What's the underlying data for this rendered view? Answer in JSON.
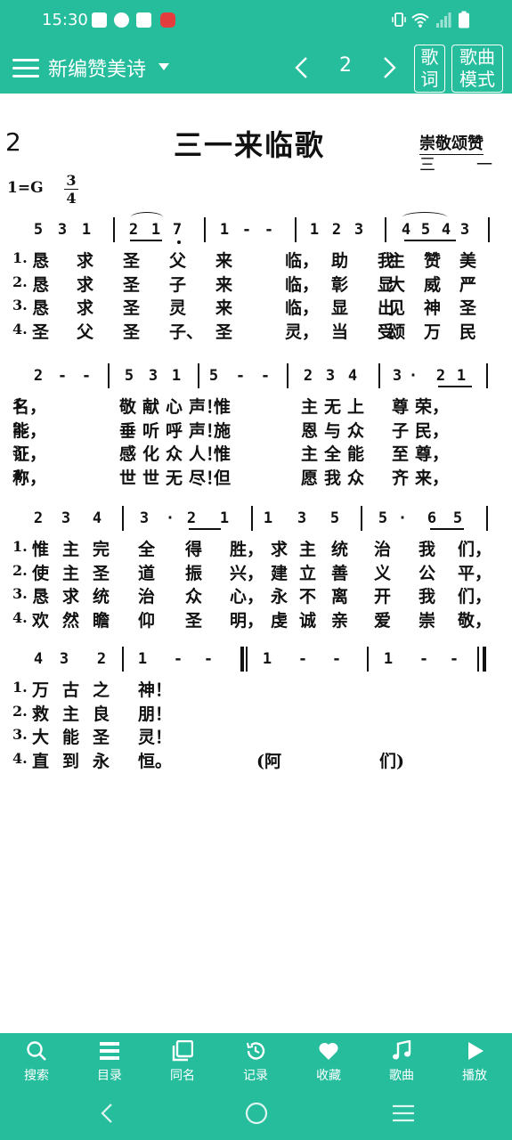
{
  "status_bar": {
    "time": "15:30"
  },
  "toolbar": {
    "book_title": "新编赞美诗",
    "page_number": "2",
    "lyrics_button": [
      "歌",
      "词"
    ],
    "score_mode_button": [
      "歌曲",
      "模式"
    ]
  },
  "score": {
    "page_number": "2",
    "title": "三一来临歌",
    "tune_name": "崇敬颂赞",
    "tune_sub": [
      "三",
      "一"
    ],
    "key": "1=G",
    "time_signature": {
      "top": "3",
      "bottom": "4"
    },
    "rows": [
      {
        "notes": [
          "5",
          "3",
          "1",
          "2",
          "1",
          "7",
          "1",
          "-",
          "-",
          "1",
          "2",
          "3",
          "4",
          "5",
          "4",
          "3"
        ],
        "verses": [
          [
            "1.",
            "恳",
            "求",
            "圣",
            "父",
            "来",
            "临，",
            "助",
            "我",
            "赞",
            "美",
            "主"
          ],
          [
            "2.",
            "恳",
            "求",
            "圣",
            "子",
            "来",
            "临，",
            "彰",
            "显",
            "威",
            "严",
            "大"
          ],
          [
            "3.",
            "恳",
            "求",
            "圣",
            "灵",
            "来",
            "临，",
            "显",
            "出",
            "神",
            "圣",
            "见"
          ],
          [
            "4.",
            "圣",
            "父",
            "圣",
            "子、",
            "圣",
            "灵，",
            "当",
            "受",
            "万",
            "民",
            "颂"
          ]
        ]
      },
      {
        "notes": [
          "2",
          "-",
          "-",
          "5",
          "3",
          "1",
          "5",
          "-",
          "-",
          "2",
          "3",
          "4",
          "3",
          "·",
          "2",
          "1"
        ],
        "verses": [
          [
            "1.",
            "名，",
            "敬",
            "献",
            "心",
            "声！",
            "惟",
            "主",
            "无",
            "上",
            "尊",
            "荣，"
          ],
          [
            "2.",
            "能，",
            "垂",
            "听",
            "呼",
            "声！",
            "施",
            "恩",
            "与",
            "众",
            "子",
            "民，"
          ],
          [
            "3.",
            "证，",
            "感",
            "化",
            "众",
            "人！",
            "惟",
            "主",
            "全",
            "能",
            "至",
            "尊，"
          ],
          [
            "4.",
            "称，",
            "世",
            "世",
            "无",
            "尽！",
            "但",
            "愿",
            "我",
            "众",
            "齐",
            "来，"
          ]
        ]
      },
      {
        "notes": [
          "2",
          "3",
          "4",
          "3",
          "·",
          "2",
          "1",
          "1",
          "3",
          "5",
          "5",
          "·",
          "6",
          "5"
        ],
        "verses": [
          [
            "1.",
            "惟",
            "主",
            "完",
            "全",
            "得",
            "胜，",
            "求",
            "主",
            "统",
            "治",
            "我",
            "们，"
          ],
          [
            "2.",
            "使",
            "主",
            "圣",
            "道",
            "振",
            "兴，",
            "建",
            "立",
            "善",
            "义",
            "公",
            "平，"
          ],
          [
            "3.",
            "恳",
            "求",
            "统",
            "治",
            "众",
            "心，",
            "永",
            "不",
            "离",
            "开",
            "我",
            "们，"
          ],
          [
            "4.",
            "欢",
            "然",
            "瞻",
            "仰",
            "圣",
            "明，",
            "虔",
            "诚",
            "亲",
            "爱",
            "崇",
            "敬，"
          ]
        ]
      },
      {
        "notes": [
          "4",
          "3",
          "2",
          "1",
          "-",
          "-",
          "1",
          "-",
          "-",
          "1",
          "-",
          "-"
        ],
        "verses": [
          [
            "1.",
            "万",
            "古",
            "之",
            "神！"
          ],
          [
            "2.",
            "救",
            "主",
            "良",
            "朋！"
          ],
          [
            "3.",
            "大",
            "能",
            "圣",
            "灵！"
          ],
          [
            "4.",
            "直",
            "到",
            "永",
            "恒。"
          ]
        ],
        "amen": [
          "(阿",
          "们)"
        ]
      }
    ]
  },
  "bottom_nav": {
    "items": [
      {
        "label": "搜索",
        "icon": "search-icon"
      },
      {
        "label": "目录",
        "icon": "list-icon"
      },
      {
        "label": "同名",
        "icon": "copy-icon"
      },
      {
        "label": "记录",
        "icon": "history-icon"
      },
      {
        "label": "收藏",
        "icon": "heart-icon"
      },
      {
        "label": "歌曲",
        "icon": "music-note-icon"
      },
      {
        "label": "播放",
        "icon": "play-icon"
      }
    ]
  },
  "colors": {
    "accent": "#26bd9d",
    "text": "#111111",
    "background": "#ffffff"
  }
}
